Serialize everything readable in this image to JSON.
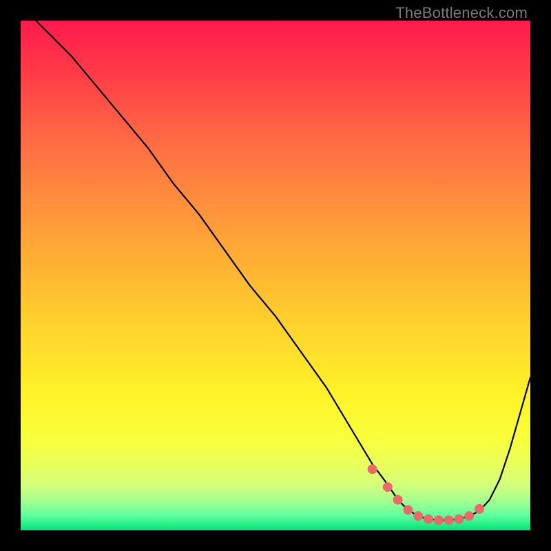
{
  "watermark": "TheBottleneck.com",
  "chart_data": {
    "type": "line",
    "title": "",
    "xlabel": "",
    "ylabel": "",
    "xlim": [
      0,
      100
    ],
    "ylim": [
      0,
      100
    ],
    "grid": false,
    "series": [
      {
        "name": "bottleneck-curve",
        "x": [
          3,
          6,
          10,
          15,
          20,
          25,
          30,
          35,
          40,
          45,
          50,
          55,
          60,
          63,
          66,
          69,
          72,
          74,
          76,
          78,
          80,
          82,
          84,
          86,
          88,
          90,
          92,
          94,
          96,
          98,
          100
        ],
        "y": [
          100,
          97,
          93,
          87,
          81,
          75,
          68,
          62,
          55,
          48,
          42,
          35,
          28,
          23,
          18,
          13,
          9,
          6,
          4,
          2.8,
          2.2,
          2.0,
          2.0,
          2.2,
          2.8,
          3.8,
          6,
          10,
          16,
          23,
          30
        ]
      }
    ],
    "markers": {
      "name": "optimal-zone",
      "x": [
        69,
        72,
        74,
        76,
        78,
        80,
        82,
        84,
        86,
        88,
        90
      ],
      "y": [
        12,
        8.5,
        6,
        4,
        2.8,
        2.2,
        2.0,
        2.0,
        2.2,
        2.8,
        4.2
      ],
      "color": "#ea6a6a",
      "size": 7
    },
    "background_gradient": {
      "top": "#ff1a4d",
      "bottom": "#00e47a"
    }
  }
}
